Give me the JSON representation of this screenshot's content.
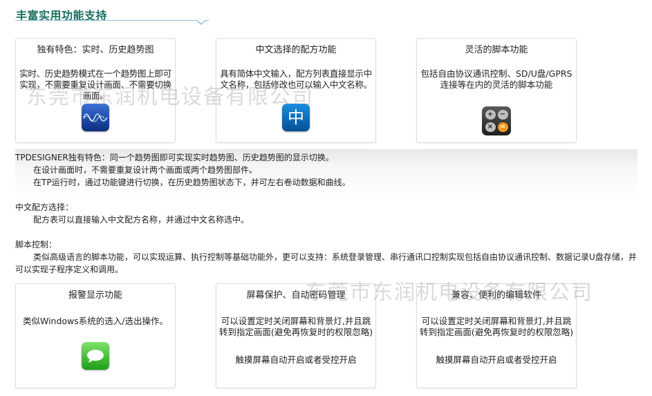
{
  "section_title": "丰富实用功能支持",
  "top_cards": [
    {
      "title": "独有特色：实时、历史趋势图",
      "desc": "实时、历史趋势模式在一个趋势图上即可实现，不需要重复设计画面、不需要切换画面。",
      "icon": "wave-icon"
    },
    {
      "title": "中文选择的配方功能",
      "desc": "具有简体中文输入，配方列表直接显示中文名称，包括修改也可以输入中文名称。",
      "icon": "chinese-input-icon",
      "icon_glyph": "中"
    },
    {
      "title": "灵活的脚本功能",
      "desc": "包括自由协议通讯控制、SD/U盘/GPRS连接等在内的灵活的脚本功能",
      "icon": "calculator-icon",
      "calc_keys": [
        "+",
        "−",
        "×",
        "="
      ]
    }
  ],
  "details": {
    "trend_heading": "TPDESIGNER独有特色：同一个趋势图即可实现实时趋势图、历史趋势图的显示切换。",
    "trend_line1": "在设计画面时，不需要重复设计两个画面或两个趋势图部件。",
    "trend_line2": "在TP运行时，通过功能键进行切换，在历史趋势图状态下，并可左右卷动数据和曲线。",
    "recipe_heading": "中文配方选择：",
    "recipe_line1": "配方表可以直接输入中文配方名称，并通过中文名称选中。",
    "script_heading": "脚本控制：",
    "script_line1": "类似高级语言的脚本功能，可以实现运算、执行控制等基础功能外，更可以支持：系统登录管理、串行通讯口控制实现包括自由协议通讯控制、数据记录U盘存储，并可以实现子程序定义和调用。"
  },
  "bottom_cards": [
    {
      "title": "报警显示功能",
      "desc": "类似Windows系统的选入/选出操作。",
      "icon": "message-icon"
    },
    {
      "title": "屏幕保护、自动密码管理",
      "desc1": "可以设置定时关闭屏幕和背景灯,并且跳转到指定画面(避免再恢复时的权限忽略)",
      "desc2": "触摸屏幕自动开启或者受控开启"
    },
    {
      "title": "兼容、便利的编辑软件",
      "desc1": "可以设置定时关闭屏幕和背景灯,并且跳转到指定画面(避免再恢复时的权限忽略)",
      "desc2": "触摸屏幕自动开启或者受控开启"
    }
  ],
  "watermarks": [
    "东莞市东润机电设备有限公司",
    "东莞市东润机电设备有限公司"
  ]
}
